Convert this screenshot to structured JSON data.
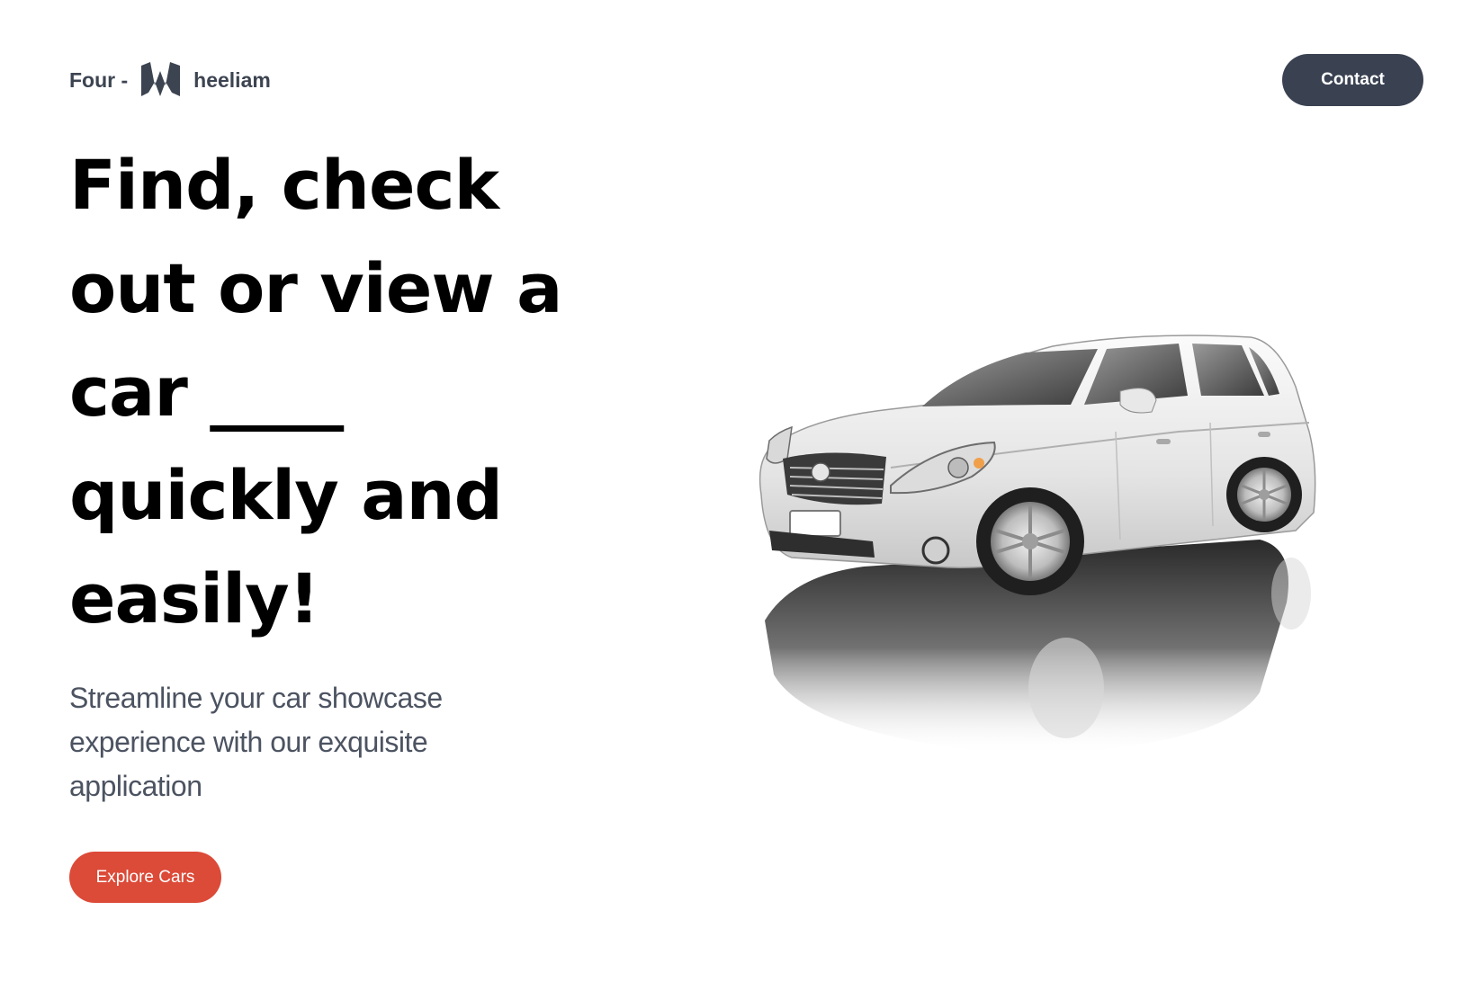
{
  "header": {
    "brand_prefix": "Four -",
    "brand_suffix": "heeliam",
    "logo_icon": "w-logo-icon",
    "contact_label": "Contact"
  },
  "hero": {
    "headline_lines": [
      "Find, check",
      "out or view a",
      "car ____",
      "quickly and",
      "easily!"
    ],
    "subtitle": "Streamline your car showcase experience with our exquisite application",
    "cta_label": "Explore Cars",
    "image_subject": "white-hatchback-car"
  },
  "colors": {
    "dark_button": "#3a4252",
    "accent_button": "#dc4a38",
    "headline": "#000000",
    "subtitle": "#4c5361"
  }
}
